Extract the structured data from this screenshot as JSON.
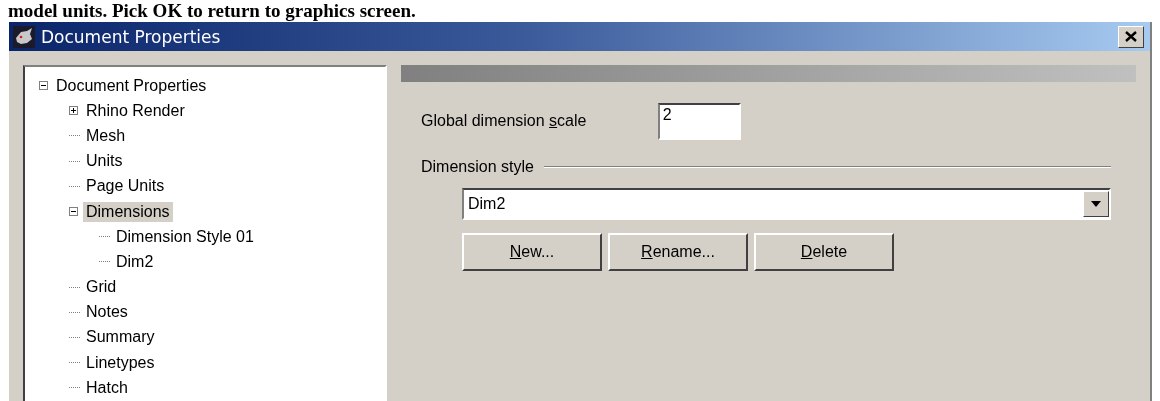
{
  "caption": "model units. Pick OK to return to graphics screen.",
  "window": {
    "title": "Document Properties"
  },
  "tree": [
    {
      "label": "Document Properties",
      "expanded": true,
      "selected": false,
      "children": [
        {
          "label": "Rhino Render",
          "expanded": false,
          "selected": false
        },
        {
          "label": "Mesh",
          "selected": false
        },
        {
          "label": "Units",
          "selected": false
        },
        {
          "label": "Page Units",
          "selected": false
        },
        {
          "label": "Dimensions",
          "expanded": true,
          "selected": true,
          "children": [
            {
              "label": "Dimension Style 01",
              "selected": false
            },
            {
              "label": "Dim2",
              "selected": false
            }
          ]
        },
        {
          "label": "Grid",
          "selected": false
        },
        {
          "label": "Notes",
          "selected": false
        },
        {
          "label": "Summary",
          "selected": false
        },
        {
          "label": "Linetypes",
          "selected": false
        },
        {
          "label": "Hatch",
          "selected": false
        }
      ]
    }
  ],
  "scale": {
    "label": {
      "before": "Global dimension ",
      "key": "s",
      "after": "cale"
    },
    "value": "2"
  },
  "style_group": {
    "label": "Dimension style",
    "dropdown": {
      "value": "Dim2"
    },
    "buttons": [
      {
        "key": "N",
        "after": "ew..."
      },
      {
        "key": "R",
        "after": "ename..."
      },
      {
        "key": "D",
        "after": "elete"
      }
    ]
  }
}
